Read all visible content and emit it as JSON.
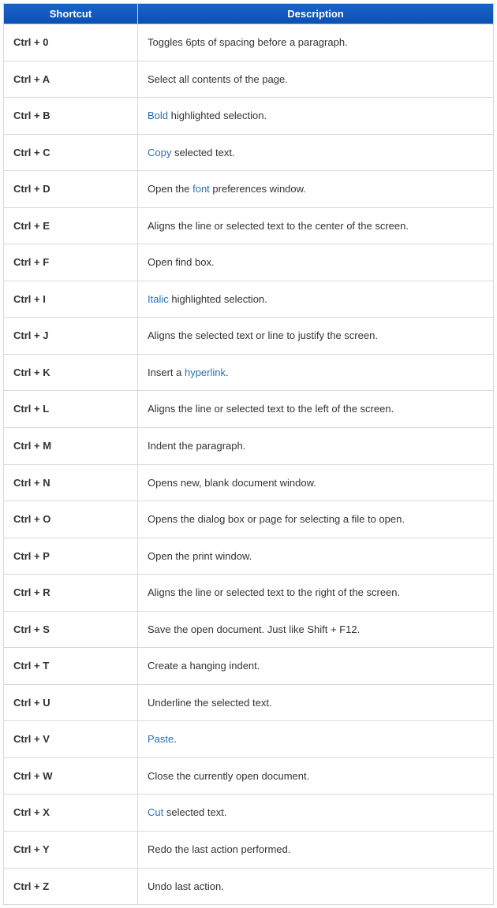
{
  "headers": {
    "shortcut": "Shortcut",
    "description": "Description"
  },
  "rows": [
    {
      "key": "Ctrl + 0",
      "desc": [
        {
          "t": "Toggles 6pts of spacing before a paragraph."
        }
      ]
    },
    {
      "key": "Ctrl + A",
      "desc": [
        {
          "t": "Select all contents of the page."
        }
      ]
    },
    {
      "key": "Ctrl + B",
      "desc": [
        {
          "l": "Bold"
        },
        {
          "t": " highlighted selection."
        }
      ]
    },
    {
      "key": "Ctrl + C",
      "desc": [
        {
          "l": "Copy"
        },
        {
          "t": " selected text."
        }
      ]
    },
    {
      "key": "Ctrl + D",
      "desc": [
        {
          "t": "Open the "
        },
        {
          "l": "font"
        },
        {
          "t": " preferences window."
        }
      ]
    },
    {
      "key": "Ctrl + E",
      "desc": [
        {
          "t": "Aligns the line or selected text to the center of the screen."
        }
      ]
    },
    {
      "key": "Ctrl + F",
      "desc": [
        {
          "t": "Open find box."
        }
      ]
    },
    {
      "key": "Ctrl + I",
      "desc": [
        {
          "l": "Italic"
        },
        {
          "t": " highlighted selection."
        }
      ]
    },
    {
      "key": "Ctrl + J",
      "desc": [
        {
          "t": "Aligns the selected text or line to justify the screen."
        }
      ]
    },
    {
      "key": "Ctrl + K",
      "desc": [
        {
          "t": "Insert a "
        },
        {
          "l": "hyperlink"
        },
        {
          "t": "."
        }
      ]
    },
    {
      "key": "Ctrl + L",
      "desc": [
        {
          "t": "Aligns the line or selected text to the left of the screen."
        }
      ]
    },
    {
      "key": "Ctrl + M",
      "desc": [
        {
          "t": "Indent the paragraph."
        }
      ]
    },
    {
      "key": "Ctrl + N",
      "desc": [
        {
          "t": "Opens new, blank document window."
        }
      ]
    },
    {
      "key": "Ctrl + O",
      "desc": [
        {
          "t": "Opens the dialog box or page for selecting a file to open."
        }
      ]
    },
    {
      "key": "Ctrl + P",
      "desc": [
        {
          "t": "Open the print window."
        }
      ]
    },
    {
      "key": "Ctrl + R",
      "desc": [
        {
          "t": "Aligns the line or selected text to the right of the screen."
        }
      ]
    },
    {
      "key": "Ctrl + S",
      "desc": [
        {
          "t": "Save the open document. Just like Shift + F12."
        }
      ]
    },
    {
      "key": "Ctrl + T",
      "desc": [
        {
          "t": "Create a hanging indent."
        }
      ]
    },
    {
      "key": "Ctrl + U",
      "desc": [
        {
          "t": "Underline the selected text."
        }
      ]
    },
    {
      "key": "Ctrl + V",
      "desc": [
        {
          "l": "Paste"
        },
        {
          "t": "."
        }
      ]
    },
    {
      "key": "Ctrl + W",
      "desc": [
        {
          "t": "Close the currently open document."
        }
      ]
    },
    {
      "key": "Ctrl + X",
      "desc": [
        {
          "l": "Cut"
        },
        {
          "t": " selected text."
        }
      ]
    },
    {
      "key": "Ctrl + Y",
      "desc": [
        {
          "t": "Redo the last action performed."
        }
      ]
    },
    {
      "key": "Ctrl + Z",
      "desc": [
        {
          "t": "Undo last action."
        }
      ]
    }
  ]
}
